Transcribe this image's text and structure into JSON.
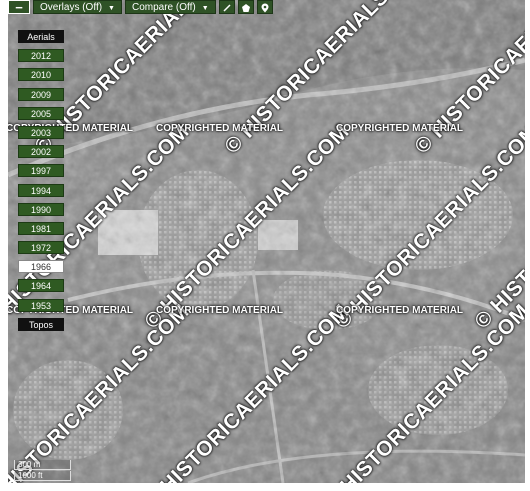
{
  "toolbar": {
    "minus": "−",
    "overlays_label": "Overlays (Off)",
    "compare_label": "Compare (Off)",
    "caret": "▼",
    "tool_icons": [
      "ruler-icon",
      "polygon-icon",
      "marker-icon"
    ]
  },
  "years": {
    "header": "Aerials",
    "items": [
      "2012",
      "2010",
      "2009",
      "2005",
      "2003",
      "2002",
      "1997",
      "1994",
      "1990",
      "1981",
      "1972",
      "1966",
      "1964",
      "1953"
    ],
    "selected": "1966",
    "footer": "Topos"
  },
  "watermark": {
    "site": "© HISTORICAERIALS.COM",
    "copyright": "COPYRIGHTED MATERIAL"
  },
  "scale": {
    "metric": "300 m",
    "imperial": "1000 ft"
  },
  "colors": {
    "button_green": "#2f5226",
    "header_black": "#111111"
  }
}
